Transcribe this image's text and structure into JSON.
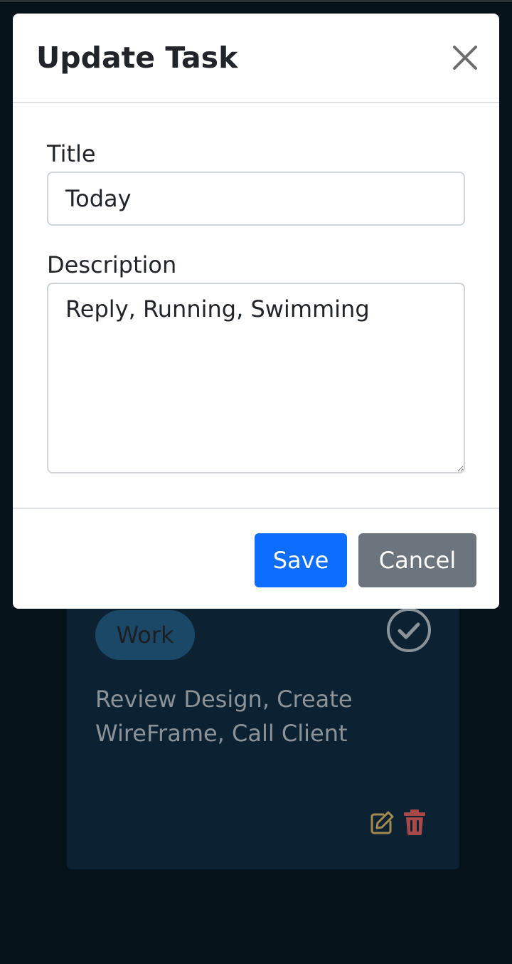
{
  "modal": {
    "title": "Update Task",
    "title_label": "Title",
    "title_value": "Today",
    "description_label": "Description",
    "description_value": "Reply, Running, Swimming",
    "save_label": "Save",
    "cancel_label": "Cancel"
  },
  "card": {
    "tag": "Work",
    "description": "Review Design, Create WireFrame, Call Client"
  },
  "icons": {
    "close": "close-icon",
    "check": "check-circle-icon",
    "edit": "edit-icon",
    "delete": "trash-icon"
  },
  "colors": {
    "background": "#06121a",
    "card": "#0c2232",
    "tag": "#1b4866",
    "primary": "#0d6efd",
    "secondary": "#6c757d",
    "edit": "#a38a4e",
    "delete": "#a84848"
  }
}
